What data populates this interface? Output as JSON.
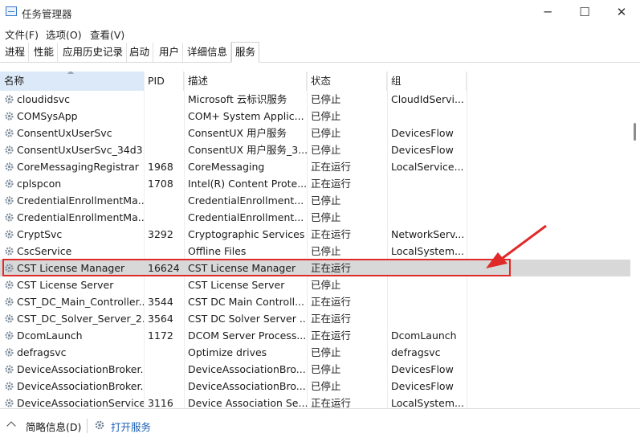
{
  "window": {
    "title": "任务管理器"
  },
  "menu": [
    "文件(F)",
    "选项(O)",
    "查看(V)"
  ],
  "tabs": [
    "进程",
    "性能",
    "应用历史记录",
    "启动",
    "用户",
    "详细信息",
    "服务"
  ],
  "active_tab": 6,
  "columns": {
    "name": "名称",
    "pid": "PID",
    "desc": "描述",
    "status": "状态",
    "group": "组"
  },
  "rows": [
    {
      "name": "cloudidsvc",
      "pid": "",
      "desc": "Microsoft 云标识服务",
      "status": "已停止",
      "group": "CloudIdServi..."
    },
    {
      "name": "COMSysApp",
      "pid": "",
      "desc": "COM+ System Applic...",
      "status": "已停止",
      "group": ""
    },
    {
      "name": "ConsentUxUserSvc",
      "pid": "",
      "desc": "ConsentUX 用户服务",
      "status": "已停止",
      "group": "DevicesFlow"
    },
    {
      "name": "ConsentUxUserSvc_34d3...",
      "pid": "",
      "desc": "ConsentUX 用户服务_3...",
      "status": "已停止",
      "group": "DevicesFlow"
    },
    {
      "name": "CoreMessagingRegistrar",
      "pid": "1968",
      "desc": "CoreMessaging",
      "status": "正在运行",
      "group": "LocalService..."
    },
    {
      "name": "cplspcon",
      "pid": "1708",
      "desc": "Intel(R) Content Prote...",
      "status": "正在运行",
      "group": ""
    },
    {
      "name": "CredentialEnrollmentMa...",
      "pid": "",
      "desc": "CredentialEnrollment...",
      "status": "已停止",
      "group": ""
    },
    {
      "name": "CredentialEnrollmentMa...",
      "pid": "",
      "desc": "CredentialEnrollment...",
      "status": "已停止",
      "group": ""
    },
    {
      "name": "CryptSvc",
      "pid": "3292",
      "desc": "Cryptographic Services",
      "status": "正在运行",
      "group": "NetworkServ..."
    },
    {
      "name": "CscService",
      "pid": "",
      "desc": "Offline Files",
      "status": "已停止",
      "group": "LocalSystem..."
    },
    {
      "name": "CST License Manager",
      "pid": "16624",
      "desc": "CST License Manager",
      "status": "正在运行",
      "group": ""
    },
    {
      "name": "CST License Server",
      "pid": "",
      "desc": "CST License Server",
      "status": "已停止",
      "group": ""
    },
    {
      "name": "CST_DC_Main_Controller...",
      "pid": "3544",
      "desc": "CST DC Main Controll...",
      "status": "正在运行",
      "group": ""
    },
    {
      "name": "CST_DC_Solver_Server_2...",
      "pid": "3564",
      "desc": "CST DC Solver Server ...",
      "status": "正在运行",
      "group": ""
    },
    {
      "name": "DcomLaunch",
      "pid": "1172",
      "desc": "DCOM Server Process...",
      "status": "正在运行",
      "group": "DcomLaunch"
    },
    {
      "name": "defragsvc",
      "pid": "",
      "desc": "Optimize drives",
      "status": "已停止",
      "group": "defragsvc"
    },
    {
      "name": "DeviceAssociationBroker...",
      "pid": "",
      "desc": "DeviceAssociationBro...",
      "status": "已停止",
      "group": "DevicesFlow"
    },
    {
      "name": "DeviceAssociationBroker...",
      "pid": "",
      "desc": "DeviceAssociationBro...",
      "status": "已停止",
      "group": "DevicesFlow"
    },
    {
      "name": "DeviceAssociationService",
      "pid": "3116",
      "desc": "Device Association Se...",
      "status": "正在运行",
      "group": "LocalSystem..."
    }
  ],
  "selected_row": 10,
  "footer": {
    "brief": "简略信息(D)",
    "open_services": "打开服务"
  },
  "colors": {
    "highlight": "#e02a2a",
    "selection": "#d8d8d8",
    "link": "#1a5fb4"
  }
}
